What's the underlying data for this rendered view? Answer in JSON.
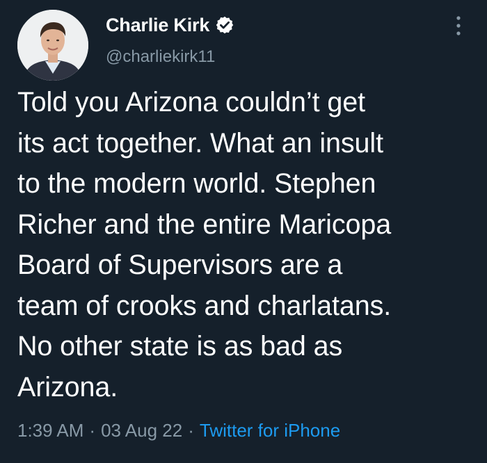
{
  "author": {
    "display_name": "Charlie Kirk",
    "handle": "@charliekirk11",
    "verified": true,
    "avatar": "avatar-photo"
  },
  "tweet": {
    "text": "Told you Arizona couldn’t get\nits act together. What an insult\nto the modern world. Stephen\nRicher and the entire Maricopa\nBoard of Supervisors are a\nteam of crooks and charlatans.\nNo other state is as bad as\nArizona.",
    "time": "1:39 AM",
    "separator": "·",
    "date": "03 Aug 22",
    "source": "Twitter for iPhone"
  },
  "icons": {
    "verified": "verified-badge-icon",
    "more": "more-options-icon"
  },
  "colors": {
    "background": "#15202b",
    "text": "#ffffff",
    "muted": "#8899a6",
    "link": "#1d9bf0"
  }
}
